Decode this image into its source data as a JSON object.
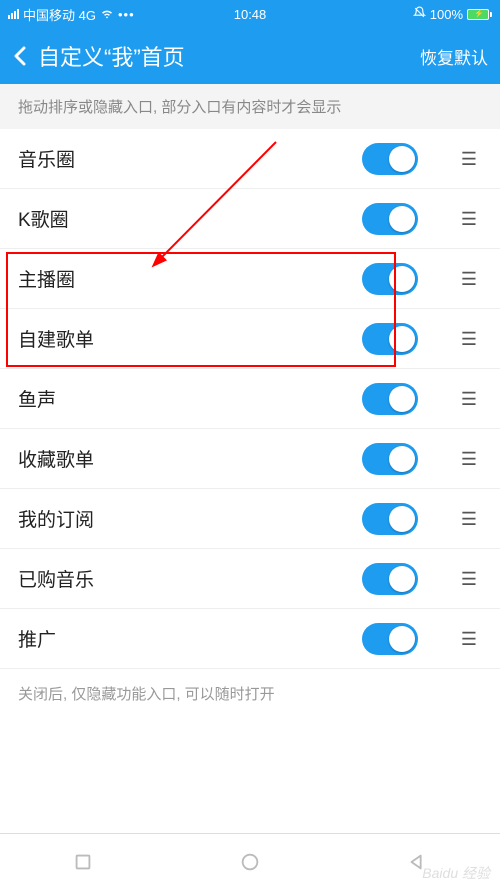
{
  "statusBar": {
    "carrier": "中国移动 4G",
    "time": "10:48",
    "batteryPct": "100%"
  },
  "nav": {
    "title": "自定义“我”首页",
    "restore": "恢复默认"
  },
  "hintTop": "拖动排序或隐藏入口, 部分入口有内容时才会显示",
  "items": [
    {
      "label": "音乐圈"
    },
    {
      "label": "K歌圈"
    },
    {
      "label": "主播圈"
    },
    {
      "label": "自建歌单"
    },
    {
      "label": "鱼声"
    },
    {
      "label": "收藏歌单"
    },
    {
      "label": "我的订阅"
    },
    {
      "label": "已购音乐"
    },
    {
      "label": "推广"
    }
  ],
  "hintBottom": "关闭后, 仅隐藏功能入口, 可以随时打开",
  "watermark": "Baidu 经验"
}
